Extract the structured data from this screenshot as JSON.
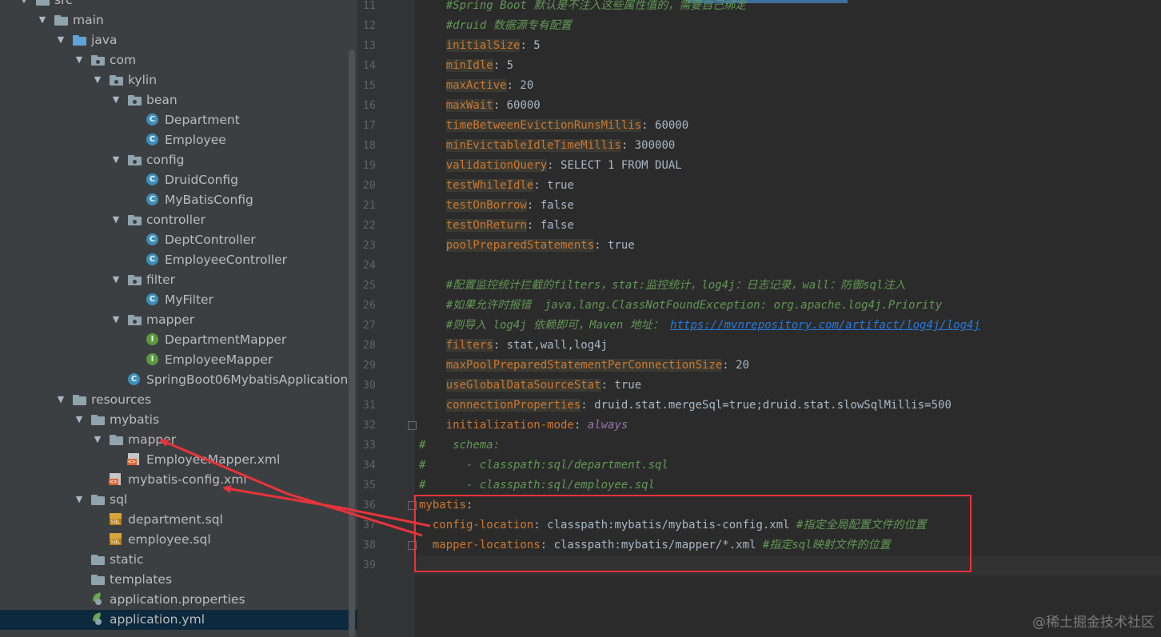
{
  "tree": {
    "rows": [
      {
        "label": "src",
        "depth": 0,
        "icon": "folder",
        "open": true
      },
      {
        "label": "main",
        "depth": 1,
        "icon": "folder",
        "open": true
      },
      {
        "label": "java",
        "depth": 2,
        "icon": "folder-blue",
        "open": true
      },
      {
        "label": "com",
        "depth": 3,
        "icon": "package",
        "open": true
      },
      {
        "label": "kylin",
        "depth": 4,
        "icon": "package",
        "open": true
      },
      {
        "label": "bean",
        "depth": 5,
        "icon": "package",
        "open": true
      },
      {
        "label": "Department",
        "depth": 6,
        "icon": "class"
      },
      {
        "label": "Employee",
        "depth": 6,
        "icon": "class"
      },
      {
        "label": "config",
        "depth": 5,
        "icon": "package",
        "open": true
      },
      {
        "label": "DruidConfig",
        "depth": 6,
        "icon": "class"
      },
      {
        "label": "MyBatisConfig",
        "depth": 6,
        "icon": "class"
      },
      {
        "label": "controller",
        "depth": 5,
        "icon": "package",
        "open": true
      },
      {
        "label": "DeptController",
        "depth": 6,
        "icon": "class"
      },
      {
        "label": "EmployeeController",
        "depth": 6,
        "icon": "class"
      },
      {
        "label": "filter",
        "depth": 5,
        "icon": "package",
        "open": true
      },
      {
        "label": "MyFilter",
        "depth": 6,
        "icon": "class"
      },
      {
        "label": "mapper",
        "depth": 5,
        "icon": "package",
        "open": true
      },
      {
        "label": "DepartmentMapper",
        "depth": 6,
        "icon": "interface"
      },
      {
        "label": "EmployeeMapper",
        "depth": 6,
        "icon": "interface"
      },
      {
        "label": "SpringBoot06MybatisApplication",
        "depth": 5,
        "icon": "class"
      },
      {
        "label": "resources",
        "depth": 2,
        "icon": "resources",
        "open": true
      },
      {
        "label": "mybatis",
        "depth": 3,
        "icon": "folder",
        "open": true
      },
      {
        "label": "mapper",
        "depth": 4,
        "icon": "folder",
        "open": true
      },
      {
        "label": "EmployeeMapper.xml",
        "depth": 5,
        "icon": "xml"
      },
      {
        "label": "mybatis-config.xml",
        "depth": 4,
        "icon": "xml"
      },
      {
        "label": "sql",
        "depth": 3,
        "icon": "folder",
        "open": true
      },
      {
        "label": "department.sql",
        "depth": 4,
        "icon": "sql"
      },
      {
        "label": "employee.sql",
        "depth": 4,
        "icon": "sql"
      },
      {
        "label": "static",
        "depth": 3,
        "icon": "folder"
      },
      {
        "label": "templates",
        "depth": 3,
        "icon": "folder"
      },
      {
        "label": "application.properties",
        "depth": 3,
        "icon": "spring"
      },
      {
        "label": "application.yml",
        "depth": 3,
        "icon": "spring",
        "selected": true
      }
    ]
  },
  "editor": {
    "lines": [
      {
        "n": "11",
        "parts": [
          {
            "t": "c",
            "s": "    #Spring Boot 默认是不注入这些属性值的，需要自己绑定"
          }
        ]
      },
      {
        "n": "12",
        "parts": [
          {
            "t": "c",
            "s": "    #druid 数据源专有配置"
          }
        ]
      },
      {
        "n": "13",
        "parts": [
          {
            "t": "p",
            "s": "    "
          },
          {
            "t": "k",
            "s": "initialSize"
          },
          {
            "t": "p",
            "s": ": 5"
          }
        ]
      },
      {
        "n": "14",
        "parts": [
          {
            "t": "p",
            "s": "    "
          },
          {
            "t": "k",
            "s": "minIdle"
          },
          {
            "t": "p",
            "s": ": 5"
          }
        ]
      },
      {
        "n": "15",
        "parts": [
          {
            "t": "p",
            "s": "    "
          },
          {
            "t": "k",
            "s": "maxActive"
          },
          {
            "t": "p",
            "s": ": 20"
          }
        ]
      },
      {
        "n": "16",
        "parts": [
          {
            "t": "p",
            "s": "    "
          },
          {
            "t": "k",
            "s": "maxWait"
          },
          {
            "t": "p",
            "s": ": 60000"
          }
        ]
      },
      {
        "n": "17",
        "parts": [
          {
            "t": "p",
            "s": "    "
          },
          {
            "t": "k",
            "s": "timeBetweenEvictionRunsMillis"
          },
          {
            "t": "p",
            "s": ": 60000"
          }
        ]
      },
      {
        "n": "18",
        "parts": [
          {
            "t": "p",
            "s": "    "
          },
          {
            "t": "k",
            "s": "minEvictableIdleTimeMillis"
          },
          {
            "t": "p",
            "s": ": 300000"
          }
        ]
      },
      {
        "n": "19",
        "parts": [
          {
            "t": "p",
            "s": "    "
          },
          {
            "t": "k",
            "s": "validationQuery"
          },
          {
            "t": "p",
            "s": ": SELECT 1 FROM DUAL"
          }
        ]
      },
      {
        "n": "20",
        "parts": [
          {
            "t": "p",
            "s": "    "
          },
          {
            "t": "k",
            "s": "testWhileIdle"
          },
          {
            "t": "p",
            "s": ": true"
          }
        ]
      },
      {
        "n": "21",
        "parts": [
          {
            "t": "p",
            "s": "    "
          },
          {
            "t": "k",
            "s": "testOnBorrow"
          },
          {
            "t": "p",
            "s": ": false"
          }
        ]
      },
      {
        "n": "22",
        "parts": [
          {
            "t": "p",
            "s": "    "
          },
          {
            "t": "k",
            "s": "testOnReturn"
          },
          {
            "t": "p",
            "s": ": false"
          }
        ]
      },
      {
        "n": "23",
        "parts": [
          {
            "t": "p",
            "s": "    "
          },
          {
            "t": "k",
            "s": "poolPreparedStatements"
          },
          {
            "t": "p",
            "s": ": true"
          }
        ]
      },
      {
        "n": "24",
        "parts": []
      },
      {
        "n": "25",
        "parts": [
          {
            "t": "c",
            "s": "    #配置监控统计拦截的filters，stat:监控统计，log4j：日志记录，wall：防御sql注入"
          }
        ]
      },
      {
        "n": "26",
        "parts": [
          {
            "t": "c",
            "s": "    #如果允许时报错  java.lang.ClassNotFoundException: org.apache.log4j.Priority"
          }
        ]
      },
      {
        "n": "27",
        "parts": [
          {
            "t": "c",
            "s": "    #则导入 log4j 依赖即可，Maven 地址： "
          },
          {
            "t": "u",
            "s": "https://mvnrepository.com/artifact/log4j/log4j"
          }
        ]
      },
      {
        "n": "28",
        "parts": [
          {
            "t": "p",
            "s": "    "
          },
          {
            "t": "k",
            "s": "filters"
          },
          {
            "t": "p",
            "s": ": stat,wall,log4j"
          }
        ]
      },
      {
        "n": "29",
        "parts": [
          {
            "t": "p",
            "s": "    "
          },
          {
            "t": "k",
            "s": "maxPoolPreparedStatementPerConnectionSize"
          },
          {
            "t": "p",
            "s": ": 20"
          }
        ]
      },
      {
        "n": "30",
        "parts": [
          {
            "t": "p",
            "s": "    "
          },
          {
            "t": "k",
            "s": "useGlobalDataSourceStat"
          },
          {
            "t": "p",
            "s": ": true"
          }
        ]
      },
      {
        "n": "31",
        "parts": [
          {
            "t": "p",
            "s": "    "
          },
          {
            "t": "k",
            "s": "connectionProperties"
          },
          {
            "t": "p",
            "s": ": druid.stat.mergeSql=true;druid.stat.slowSqlMillis=500"
          }
        ]
      },
      {
        "n": "32",
        "parts": [
          {
            "t": "p",
            "s": "    "
          },
          {
            "t": "k2",
            "s": "initialization-mode"
          },
          {
            "t": "p",
            "s": ": "
          },
          {
            "t": "v",
            "s": "always"
          }
        ]
      },
      {
        "n": "33",
        "parts": [
          {
            "t": "c",
            "s": "#    schema:"
          }
        ]
      },
      {
        "n": "34",
        "parts": [
          {
            "t": "c",
            "s": "#      - classpath:sql/department.sql"
          }
        ]
      },
      {
        "n": "35",
        "parts": [
          {
            "t": "c",
            "s": "#      - classpath:sql/employee.sql"
          }
        ]
      },
      {
        "n": "36",
        "parts": [
          {
            "t": "k2",
            "s": "mybatis"
          },
          {
            "t": "p",
            "s": ":"
          }
        ]
      },
      {
        "n": "37",
        "parts": [
          {
            "t": "p",
            "s": "  "
          },
          {
            "t": "k2",
            "s": "config-location"
          },
          {
            "t": "p",
            "s": ": classpath:mybatis/mybatis-config.xml "
          },
          {
            "t": "c",
            "s": "#指定全局配置文件的位置"
          }
        ]
      },
      {
        "n": "38",
        "parts": [
          {
            "t": "p",
            "s": "  "
          },
          {
            "t": "k2",
            "s": "mapper-locations"
          },
          {
            "t": "p",
            "s": ": classpath:mybatis/mapper/*.xml "
          },
          {
            "t": "c",
            "s": "#指定sql映射文件的位置"
          }
        ]
      },
      {
        "n": "39",
        "parts": []
      }
    ]
  },
  "watermark": "@稀土掘金技术社区",
  "colors": {
    "annotation": "#e8333a",
    "tree_bg": "#3c3f41",
    "editor_bg": "#2b2b2b",
    "key": "#cc7832",
    "comment": "#629755"
  }
}
